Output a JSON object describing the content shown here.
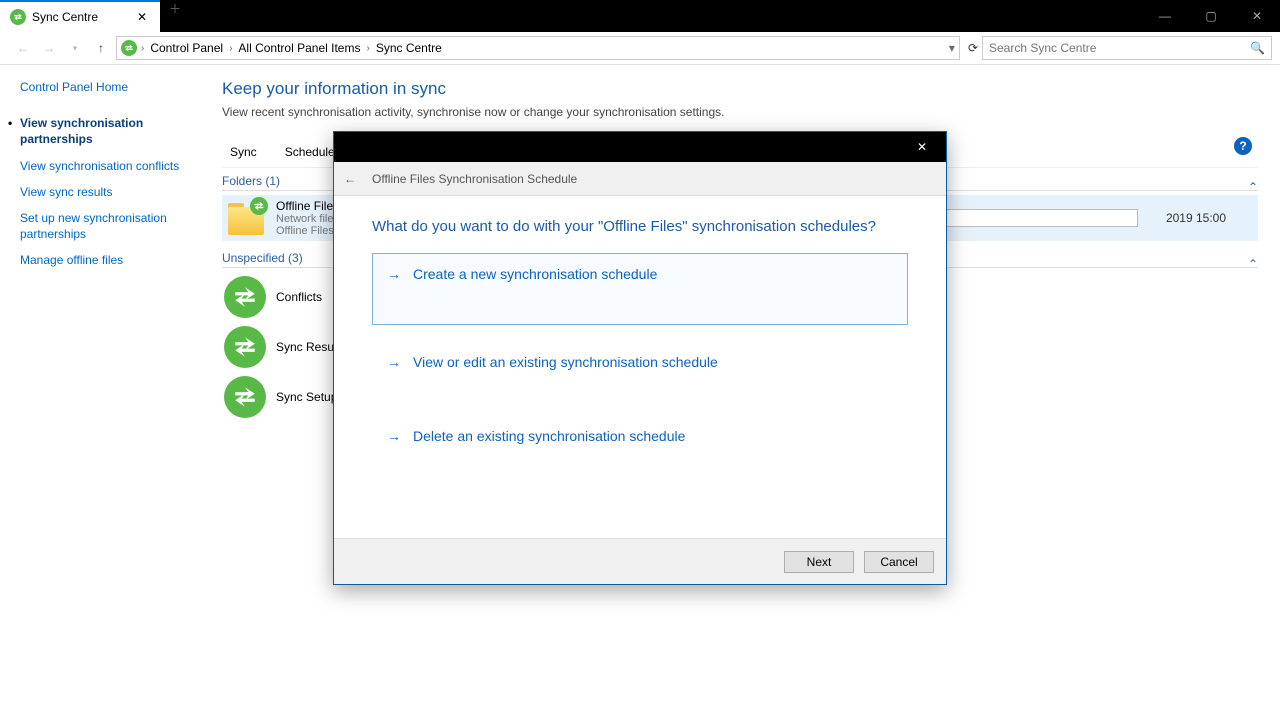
{
  "window": {
    "tab_title": "Sync Centre"
  },
  "breadcrumb": {
    "root": "Control Panel",
    "mid": "All Control Panel Items",
    "leaf": "Sync Centre"
  },
  "search": {
    "placeholder": "Search Sync Centre"
  },
  "sidebar": {
    "home": "Control Panel Home",
    "links": [
      "View synchronisation partnerships",
      "View synchronisation conflicts",
      "View sync results",
      "Set up new synchronisation partnerships",
      "Manage offline files"
    ]
  },
  "main": {
    "page_title": "Keep your information in sync",
    "page_sub": "View recent synchronisation activity, synchronise now or change your synchronisation settings.",
    "tabs": {
      "sync": "Sync",
      "schedule": "Schedule"
    },
    "folders_label": "Folders (1)",
    "offline": {
      "title": "Offline Files",
      "line1": "Network files",
      "line2": "Offline Files a"
    },
    "unspecified_label": "Unspecified (3)",
    "items": {
      "conflicts": "Conflicts",
      "results": "Sync Results",
      "setup": "Sync Setup"
    },
    "timestamp_cell": "2019 15:00"
  },
  "dialog": {
    "subbar_title": "Offline Files Synchronisation Schedule",
    "heading": "What do you want to do with your \"Offline Files\" synchronisation schedules?",
    "options": {
      "create": "Create a new synchronisation schedule",
      "view": "View or edit an existing synchronisation schedule",
      "delete": "Delete an existing synchronisation schedule"
    },
    "buttons": {
      "next": "Next",
      "cancel": "Cancel"
    }
  }
}
